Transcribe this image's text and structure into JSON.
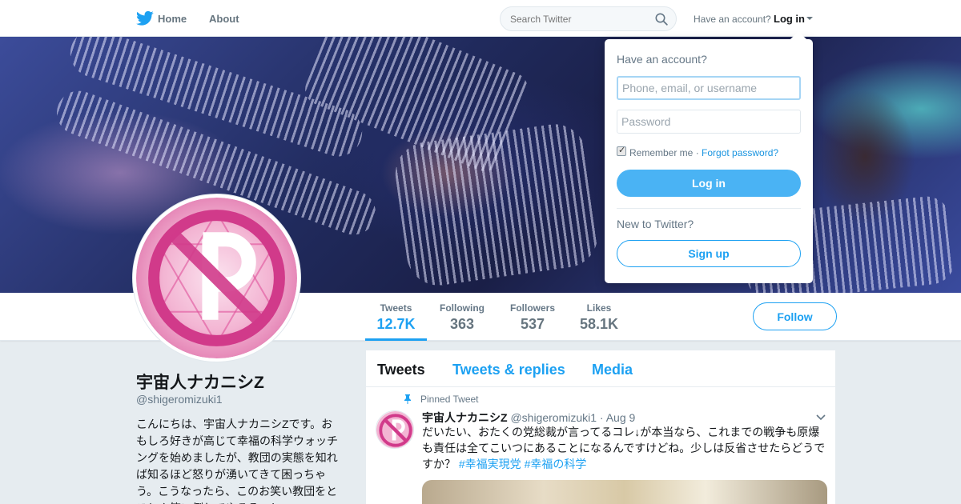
{
  "colors": {
    "brand": "#1da1f2",
    "button_fill": "#4ab3f4",
    "text_primary": "#14171a",
    "text_secondary": "#657786",
    "avatar_accent": "#e0519b"
  },
  "topnav": {
    "logo_icon": "twitter-bird-icon",
    "home_label": "Home",
    "about_label": "About",
    "search_placeholder": "Search Twitter",
    "search_icon": "search-icon",
    "have_account_label": "Have an account?",
    "login_label": "Log in",
    "login_caret_icon": "caret-down-icon"
  },
  "login_dropdown": {
    "title": "Have an account?",
    "username_placeholder": "Phone, email, or username",
    "password_placeholder": "Password",
    "remember_label": "Remember me",
    "separator": " · ",
    "forgot_label": "Forgot password?",
    "remember_checked": true,
    "login_button": "Log in",
    "new_label": "New to Twitter?",
    "signup_button": "Sign up"
  },
  "profile_stats": [
    {
      "label": "Tweets",
      "value": "12.7K",
      "active": true
    },
    {
      "label": "Following",
      "value": "363",
      "active": false
    },
    {
      "label": "Followers",
      "value": "537",
      "active": false
    },
    {
      "label": "Likes",
      "value": "58.1K",
      "active": false
    }
  ],
  "follow_button": "Follow",
  "profile": {
    "name": "宇宙人ナカニシZ",
    "handle": "@shigeromizuki1",
    "bio": "こんにちは、宇宙人ナカニシZです。おもしろ好きが高じて幸福の科学ウォッチングを始めましたが、教団の実態を知れば知るほど怒りが湧いてきて困っちゃう。こうなったら、このお笑い教団をとことん笑い倒してやるぞ〜！"
  },
  "timeline": {
    "tabs": [
      "Tweets",
      "Tweets & replies",
      "Media"
    ],
    "active_tab": "Tweets",
    "pinned_label": "Pinned Tweet",
    "pin_icon": "pin-icon",
    "more_icon": "chevron-down-icon",
    "tweet": {
      "name": "宇宙人ナカニシZ",
      "handle": "@shigeromizuki1",
      "separator": " · ",
      "date": "Aug 9",
      "text": "だいたい、おたくの党総裁が言ってるコレ↓が本当なら、これまでの戦争も原爆も責任は全てこいつにあることになるんですけどね。少しは反省させたらどうですか？ ",
      "hashtag1": "#幸福実現党",
      "hashtag_separator": " ",
      "hashtag2": "#幸福の科学"
    }
  }
}
